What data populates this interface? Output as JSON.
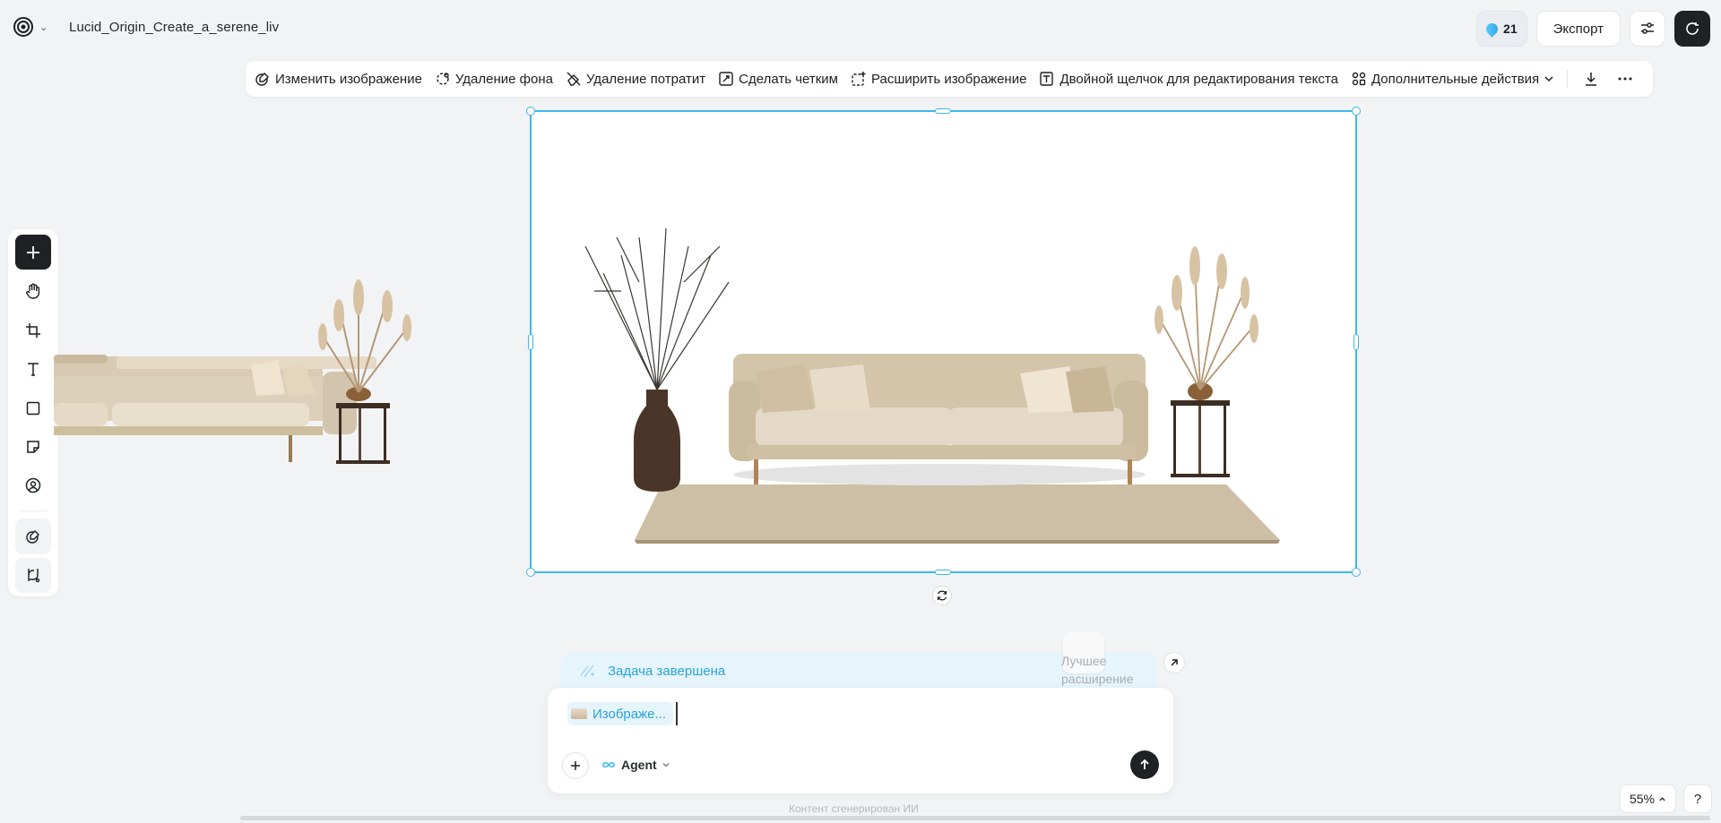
{
  "header": {
    "title": "Lucid_Origin_Create_a_serene_liv",
    "credits": "21",
    "export_label": "Экспорт"
  },
  "toolbar": {
    "items": [
      {
        "label": "Изменить изображение",
        "icon": "edit-image-icon"
      },
      {
        "label": "Удаление фона",
        "icon": "remove-background-icon"
      },
      {
        "label": "Удаление потратит",
        "icon": "eraser-icon"
      },
      {
        "label": "Сделать четким",
        "icon": "sharpen-icon"
      },
      {
        "label": "Расширить изображение",
        "icon": "expand-image-icon"
      },
      {
        "label": "Двойной щелчок для редактирования текста",
        "icon": "edit-text-icon"
      },
      {
        "label": "Дополнительные действия",
        "icon": "more-actions-icon"
      }
    ]
  },
  "sidebar": {
    "tools": [
      "add-icon",
      "hand-icon",
      "crop-frame-icon",
      "text-icon",
      "rectangle-icon",
      "sticky-note-icon",
      "avatar-icon",
      "ai-edit-icon",
      "workflow-icon"
    ]
  },
  "agent": {
    "task_status": "Задача завершена",
    "task_hint": "Лучшее расширение",
    "attachment_label": "Изображе...",
    "mode_label": "Agent",
    "footnote": "Контент сгенерирован ИИ"
  },
  "view": {
    "zoom": "55%",
    "help": "?"
  },
  "colors": {
    "accent": "#3fb7e8",
    "dark_button": "#1f2125",
    "canvas_bg": "#f2f3f5"
  }
}
